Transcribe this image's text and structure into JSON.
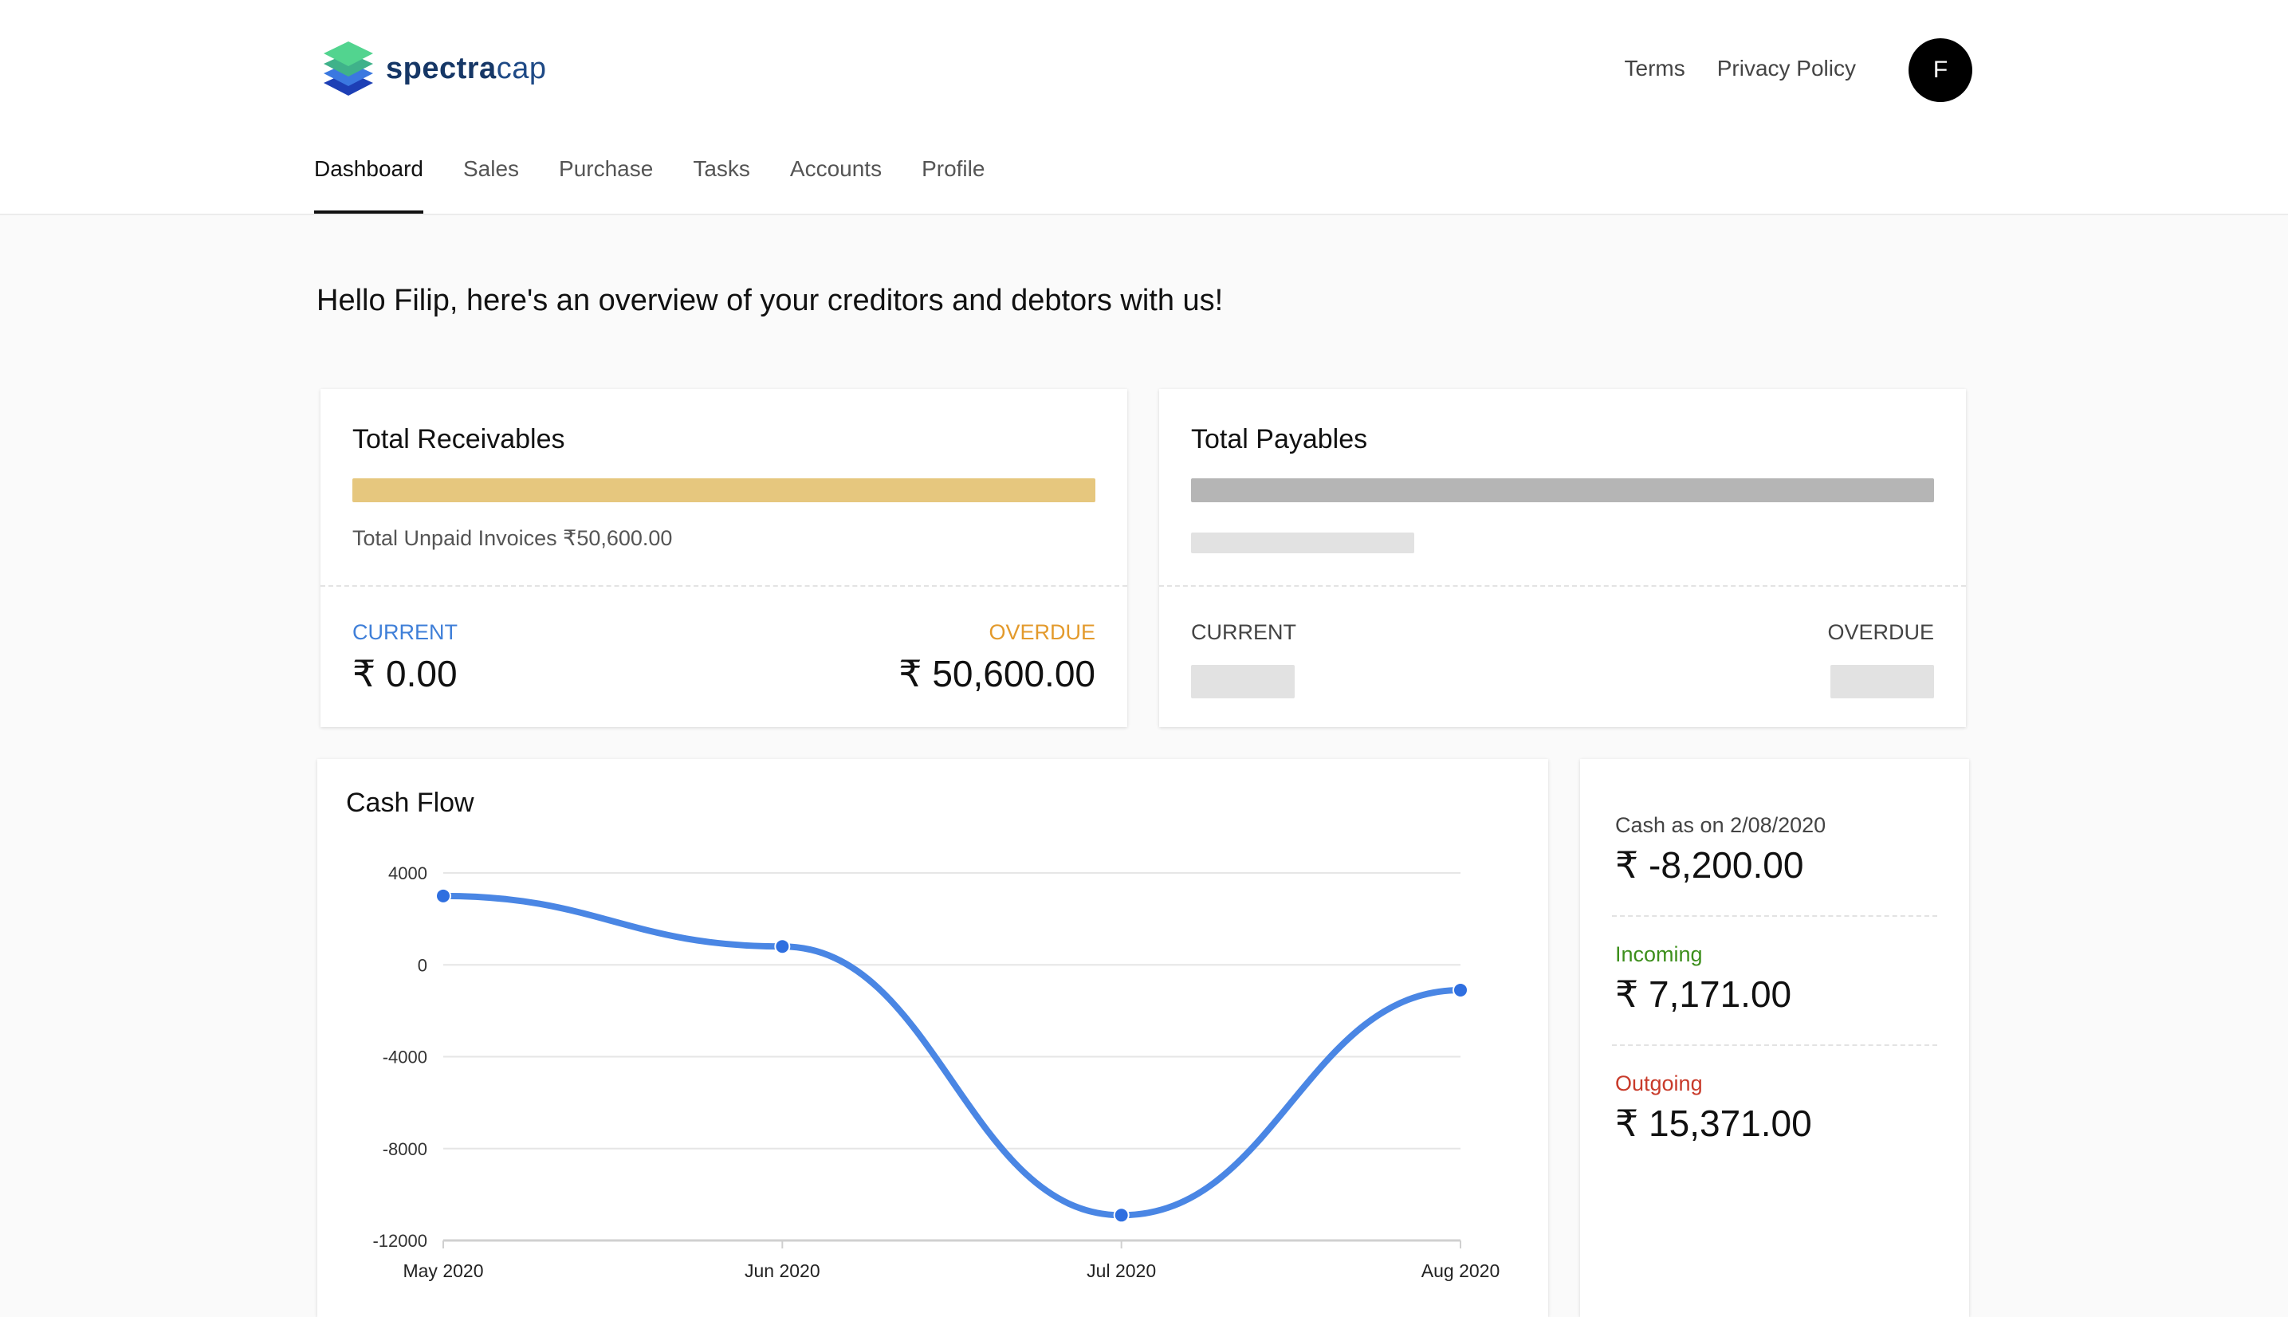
{
  "brand": {
    "name_bold": "spectra",
    "name_light": "cap"
  },
  "top_links": {
    "terms": "Terms",
    "privacy": "Privacy Policy"
  },
  "user": {
    "initial": "F"
  },
  "tabs": [
    {
      "label": "Dashboard",
      "active": true
    },
    {
      "label": "Sales"
    },
    {
      "label": "Purchase"
    },
    {
      "label": "Tasks"
    },
    {
      "label": "Accounts"
    },
    {
      "label": "Profile"
    }
  ],
  "greeting": "Hello Filip, here's an overview of your creditors and debtors with us!",
  "receivables": {
    "title": "Total Receivables",
    "unpaid": "Total Unpaid Invoices ₹50,600.00",
    "current_label": "CURRENT",
    "current_value": "₹ 0.00",
    "overdue_label": "OVERDUE",
    "overdue_value": "₹ 50,600.00",
    "bar_color": "#e6c77e"
  },
  "payables": {
    "title": "Total Payables",
    "current_label": "CURRENT",
    "overdue_label": "OVERDUE",
    "bar_color": "#b5b5b5"
  },
  "cash_flow": {
    "title": "Cash Flow"
  },
  "cash_summary": {
    "as_on_label": "Cash as on 2/08/2020",
    "as_on_value": "₹ -8,200.00",
    "incoming_label": "Incoming",
    "incoming_value": "₹ 7,171.00",
    "outgoing_label": "Outgoing",
    "outgoing_value": "₹ 15,371.00"
  },
  "colors": {
    "current_blue": "#3f7fd8",
    "overdue_orange": "#e39a2c",
    "incoming_green": "#3d8f1c",
    "outgoing_red": "#c83a2a",
    "line_blue": "#4a86e4"
  },
  "chart_data": {
    "type": "line",
    "title": "Cash Flow",
    "categories": [
      "May 2020",
      "Jun 2020",
      "Jul 2020",
      "Aug 2020"
    ],
    "series": [
      {
        "values": [
          3000,
          800,
          -10900,
          -1100
        ]
      }
    ],
    "ylim": [
      -12000,
      4000
    ],
    "yticks": [
      4000,
      0,
      -4000,
      -8000,
      -12000
    ],
    "grid": true
  }
}
